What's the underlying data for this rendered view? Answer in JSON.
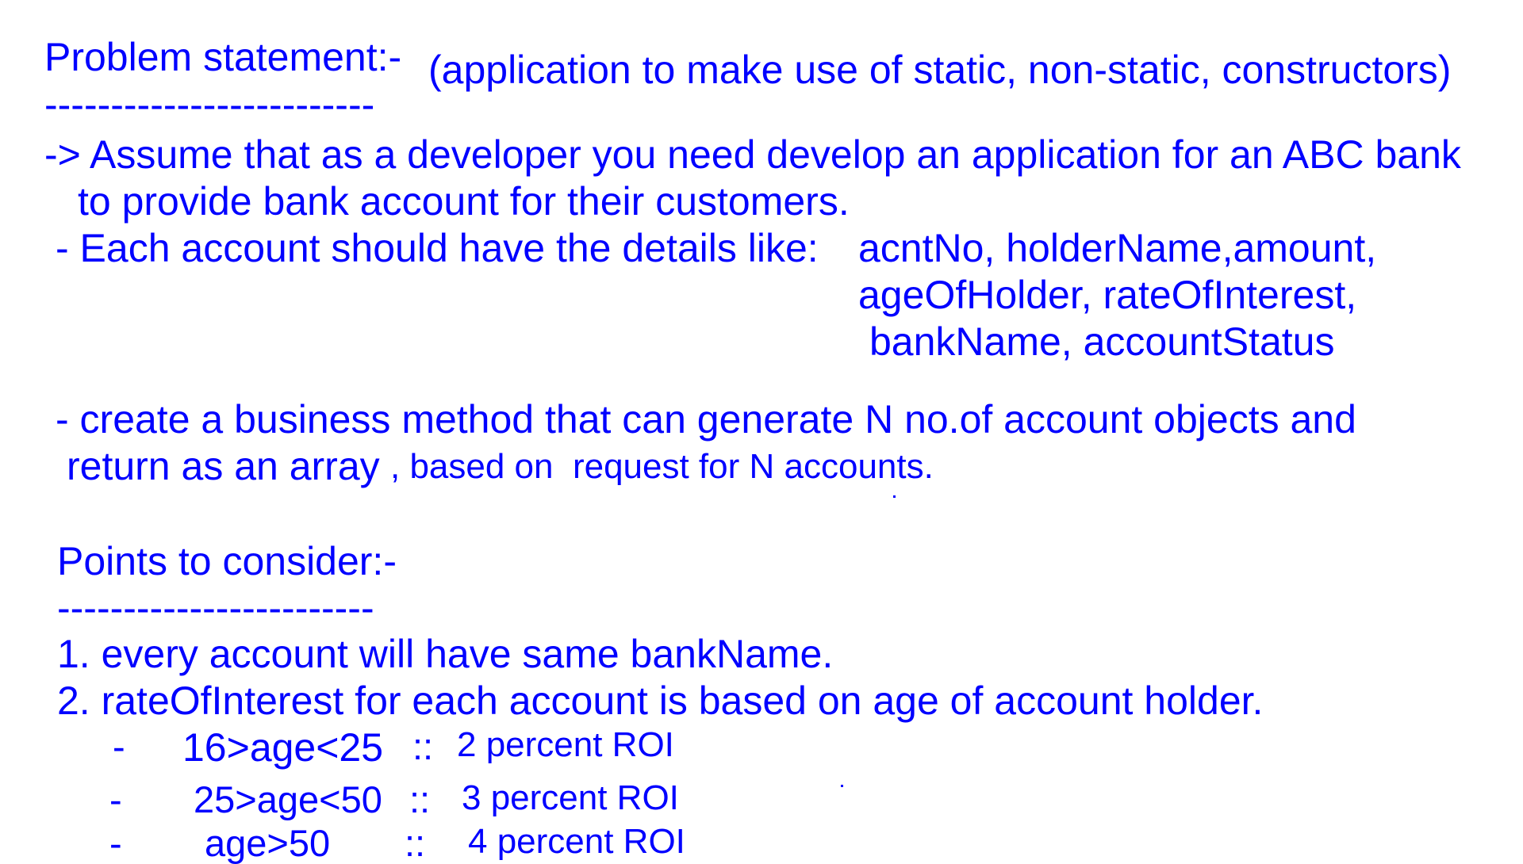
{
  "header": {
    "title": "Problem statement:-",
    "subtitle": "(application to make use of static, non-static, constructors)",
    "underline": "-------------------------"
  },
  "statement": {
    "line1": "-> Assume that as a developer you need develop an application for an ABC bank",
    "line2": "to provide bank account for their customers.",
    "details_intro": "- Each account should have the details like:",
    "details_line1": "acntNo, holderName,amount,",
    "details_line2": "ageOfHolder, rateOfInterest,",
    "details_line3": "bankName, accountStatus",
    "method_line1": "- create a business method that can generate N no.of account objects and",
    "method_line2a": "return as an array",
    "method_line2b": ", based on  request for N accounts."
  },
  "points": {
    "heading": "Points to consider:-",
    "underline": "------------------------",
    "item1": "1. every account will have same bankName.",
    "item2": "2. rateOfInterest for each account is based on age of account holder.",
    "rules": [
      {
        "dash": "-",
        "range": "16>age<25",
        "sep": "::",
        "roi": "2 percent ROI"
      },
      {
        "dash": "-",
        "range": "25>age<50",
        "sep": "::",
        "roi": "3 percent ROI"
      },
      {
        "dash": "-",
        "range": "age>50",
        "sep": "::",
        "roi": "4 percent ROI"
      }
    ]
  },
  "colors": {
    "text": "#0000ff",
    "background": "#ffffff"
  }
}
